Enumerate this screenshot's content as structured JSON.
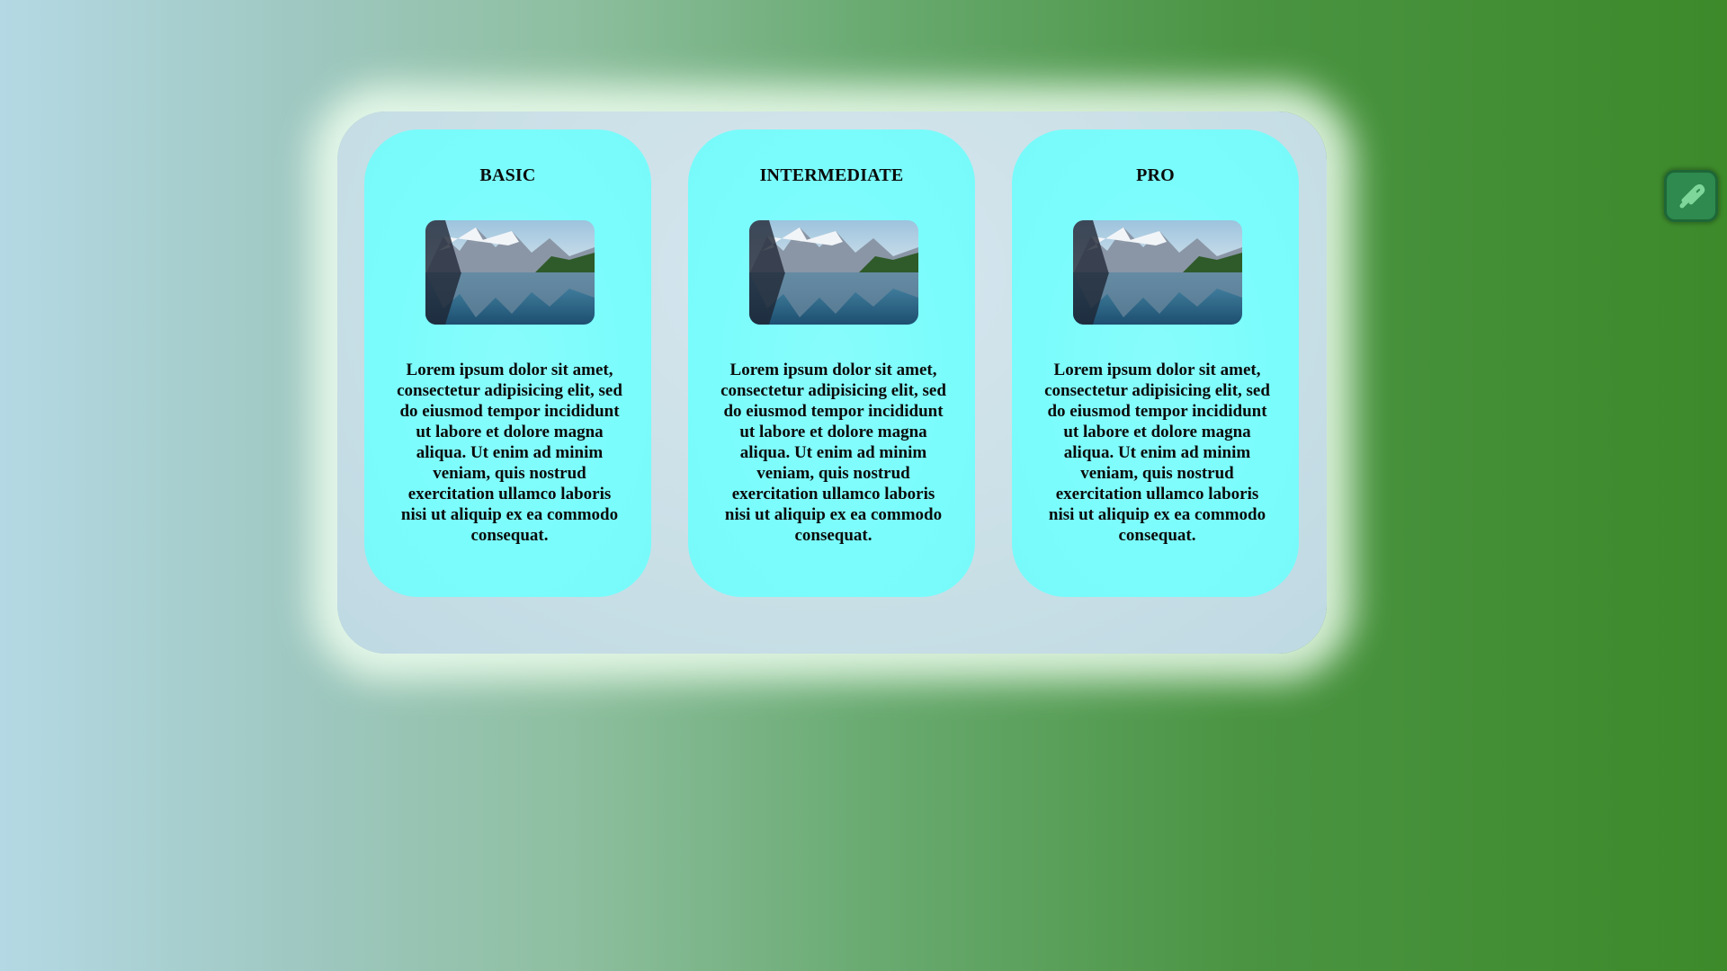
{
  "cards": [
    {
      "title": "BASIC",
      "image_alt": "mountain-lake-image",
      "text": "Lorem ipsum dolor sit amet, consectetur adipisicing elit, sed do eiusmod tempor incididunt ut labore et dolore magna aliqua. Ut enim ad minim veniam, quis nostrud exercitation ullamco laboris nisi ut aliquip ex ea commodo consequat."
    },
    {
      "title": "INTERMEDIATE",
      "image_alt": "mountain-lake-image",
      "text": "Lorem ipsum dolor sit amet, consectetur adipisicing elit, sed do eiusmod tempor incididunt ut labore et dolore magna aliqua. Ut enim ad minim veniam, quis nostrud exercitation ullamco laboris nisi ut aliquip ex ea commodo consequat."
    },
    {
      "title": "PRO",
      "image_alt": "mountain-lake-image",
      "text": "Lorem ipsum dolor sit amet, consectetur adipisicing elit, sed do eiusmod tempor incididunt ut labore et dolore magna aliqua. Ut enim ad minim veniam, quis nostrud exercitation ullamco laboris nisi ut aliquip ex ea commodo consequat."
    }
  ],
  "side_widget": {
    "icon": "extension-logo-icon"
  },
  "colors": {
    "card_background": "#7afcfc",
    "panel_background": "#c9dfe6",
    "widget_background": "#2e8a4f"
  }
}
